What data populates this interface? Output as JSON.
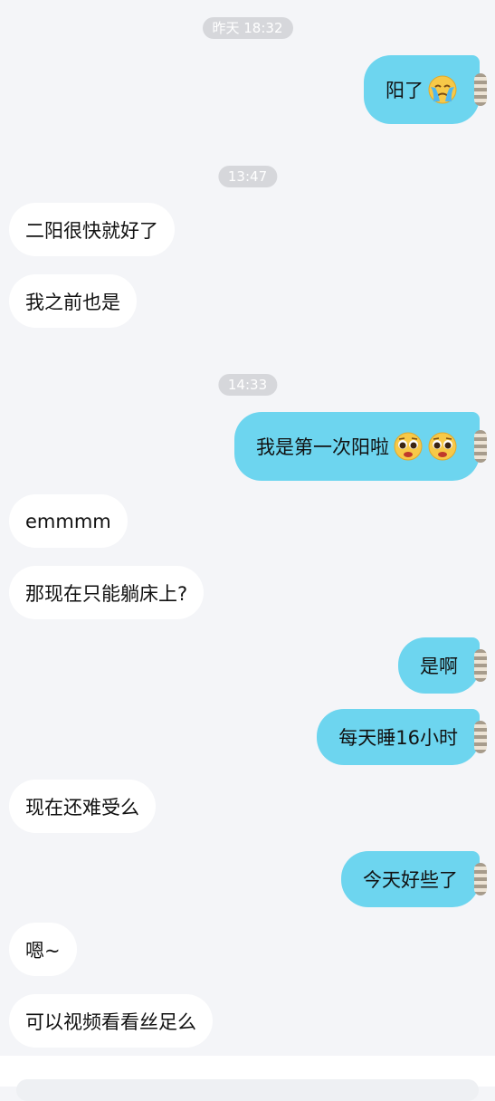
{
  "timestamps": [
    "昨天 18:32",
    "13:47",
    "14:33"
  ],
  "messages": [
    {
      "side": "out",
      "text": "阳了",
      "emojis": [
        "crying-face"
      ]
    },
    {
      "side": "in",
      "text": "二阳很快就好了"
    },
    {
      "side": "in",
      "text": "我之前也是"
    },
    {
      "side": "out",
      "text": "我是第一次阳啦",
      "emojis": [
        "pleading-face",
        "pleading-face"
      ]
    },
    {
      "side": "in",
      "text": "emmmm"
    },
    {
      "side": "in",
      "text": "那现在只能躺床上?"
    },
    {
      "side": "out",
      "text": "是啊"
    },
    {
      "side": "out",
      "text": "每天睡16小时"
    },
    {
      "side": "in",
      "text": "现在还难受么"
    },
    {
      "side": "out",
      "text": "今天好些了"
    },
    {
      "side": "in",
      "text": "嗯~"
    },
    {
      "side": "in",
      "text": "可以视频看看丝足么"
    }
  ],
  "colors": {
    "background": "#f4f5f8",
    "outgoing_bubble": "#6dd5ef",
    "incoming_bubble": "#ffffff",
    "timestamp_pill": "#d6d7db"
  }
}
